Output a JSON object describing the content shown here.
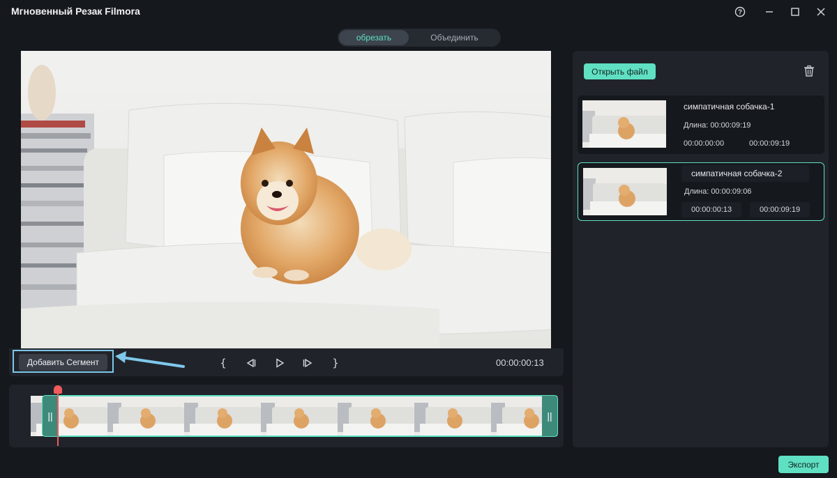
{
  "app": {
    "title": "Мгновенный Резак Filmora"
  },
  "tabs": [
    {
      "label": "обрезать",
      "active": true
    },
    {
      "label": "Объединить",
      "active": false
    }
  ],
  "player": {
    "add_segment_label": "Добавить Сегмент",
    "timecode": "00:00:00:13",
    "mark_in_icon": "bracket-left-icon",
    "mark_out_icon": "bracket-right-icon"
  },
  "panel": {
    "open_file_label": "Открыть файл",
    "clips": [
      {
        "name": "симпатичная собачка-1",
        "length": "Длина: 00:00:09:19",
        "start": "00:00:00:00",
        "end": "00:00:09:19",
        "selected": false
      },
      {
        "name": "симпатичная собачка-2",
        "length": "Длина: 00:00:09:06",
        "start": "00:00:00:13",
        "end": "00:00:09:19",
        "selected": true
      }
    ]
  },
  "export_label": "Экспорт",
  "colors": {
    "accent": "#5fe0c3",
    "background": "#15181d",
    "panel": "#20242a",
    "playhead": "#f15b5b",
    "highlight": "#7fc8ec"
  }
}
